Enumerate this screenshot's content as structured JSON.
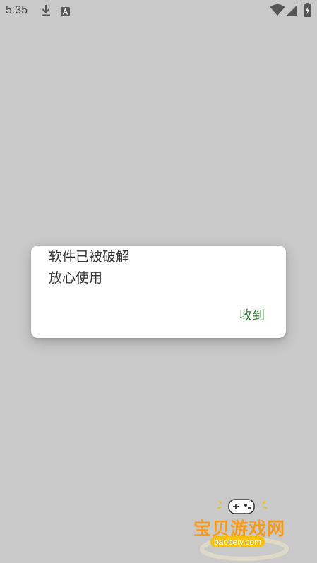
{
  "status_bar": {
    "time": "5:35",
    "icons": [
      "download-icon",
      "a-notification-icon",
      "wifi-icon",
      "signal-icon",
      "battery-charging-icon"
    ]
  },
  "dialog": {
    "title": "软件已被破解",
    "message": "放心使用",
    "confirm_label": "收到",
    "confirm_color": "#2e7d32"
  },
  "watermark": {
    "name": "宝贝游戏网",
    "url": "baobeiy.com"
  },
  "colors": {
    "background": "#c9c9c9",
    "dialog_bg": "#ffffff",
    "watermark_orange": "#f39a1f",
    "watermark_yellow": "#f4c20d"
  }
}
